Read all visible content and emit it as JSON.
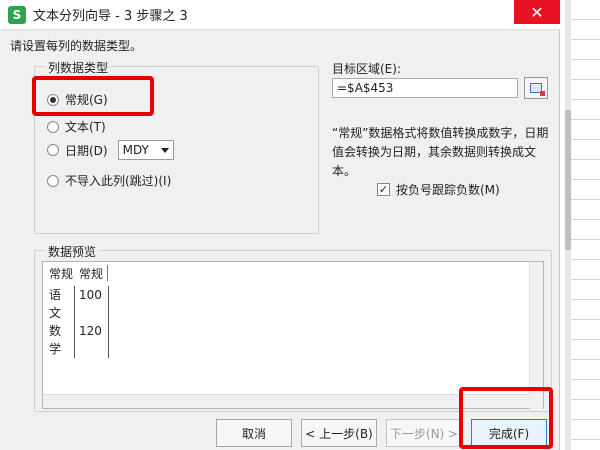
{
  "window": {
    "app_icon_letter": "S",
    "title": "文本分列向导 - 3 步骤之 3",
    "close_symbol": "✕"
  },
  "prompt": "请设置每列的数据类型。",
  "column_type": {
    "legend": "列数据类型",
    "options": [
      {
        "label": "常规(G)",
        "checked": true
      },
      {
        "label": "文本(T)",
        "checked": false
      },
      {
        "label": "日期(D)",
        "checked": false
      },
      {
        "label": "不导入此列(跳过)(I)",
        "checked": false
      }
    ],
    "date_format": "MDY"
  },
  "destination": {
    "label": "目标区域(E):",
    "value": "=$A$453"
  },
  "description": "“常规”数据格式将数值转换成数字，日期值会转换为日期，其余数据则转换成文本。",
  "negative_option": {
    "label": "按负号跟踪负数(M)",
    "checked": true,
    "check_mark": "✓"
  },
  "preview": {
    "legend": "数据预览",
    "headers": [
      "常规",
      "常规"
    ],
    "rows": [
      [
        "语文",
        "100"
      ],
      [
        "数学",
        "120"
      ]
    ]
  },
  "buttons": {
    "cancel": "取消",
    "back": "< 上一步(B)",
    "next": "下一步(N) >",
    "finish": "完成(F)"
  },
  "colors": {
    "highlight": "#e60000",
    "app_icon": "#2ea44f",
    "close": "#e81123"
  }
}
